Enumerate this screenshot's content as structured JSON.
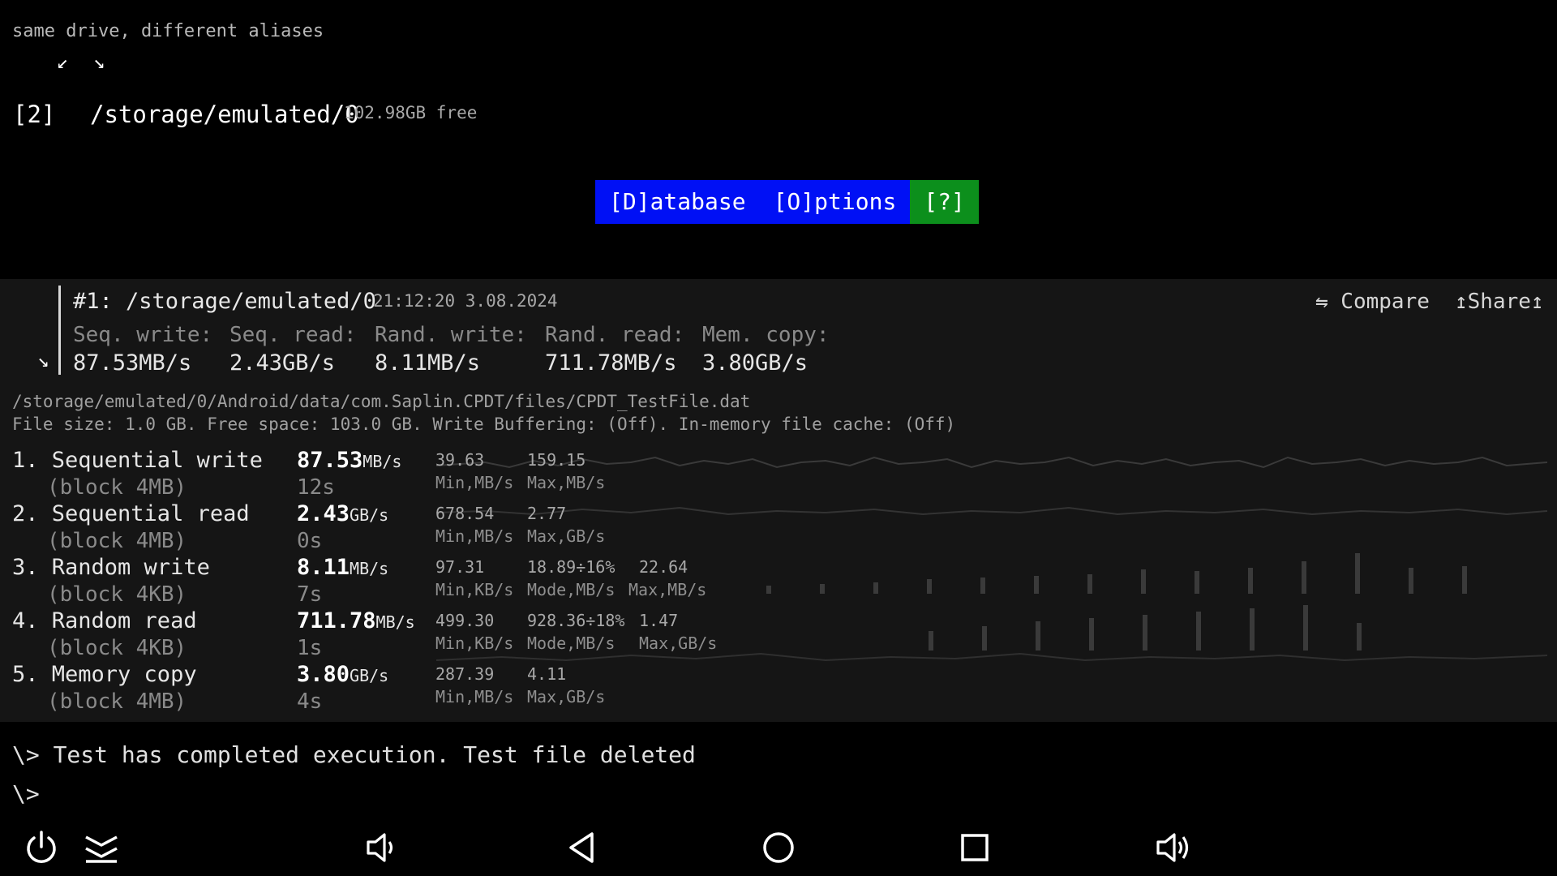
{
  "header": {
    "hint": "same drive, different aliases",
    "arrows": "↙ ↘",
    "drive_index": "[2]",
    "drive_path": "/storage/emulated/0",
    "drive_free": "102.98GB free"
  },
  "menu": {
    "database": "[D]atabase",
    "options": "[O]ptions",
    "help": "[?]"
  },
  "run": {
    "title": "#1: /storage/emulated/0",
    "timestamp": "21:12:20 3.08.2024",
    "compare": "⇋ Compare",
    "share": "↥Share↥",
    "collapse_arrow": "↘",
    "summary_labels": [
      "Seq. write:",
      "Seq. read:",
      "Rand. write:",
      "Rand. read:",
      "Mem. copy:"
    ],
    "summary_values": [
      "87.53MB/s",
      "2.43GB/s",
      "8.11MB/s",
      "711.78MB/s",
      "3.80GB/s"
    ]
  },
  "file": {
    "path": "/storage/emulated/0/Android/data/com.Saplin.CPDT/files/CPDT_TestFile.dat",
    "info": "File size: 1.0 GB. Free space: 103.0 GB. Write Buffering: (Off). In-memory file cache: (Off)"
  },
  "tests": [
    {
      "name": "1. Sequential write",
      "block": "(block 4MB)",
      "speed": "87.53",
      "unit": "MB/s",
      "duration": "12s",
      "stats": [
        "39.63",
        "159.15"
      ],
      "stat_labels": [
        "Min,MB/s",
        "Max,MB/s"
      ]
    },
    {
      "name": "2. Sequential read",
      "block": "(block 4MB)",
      "speed": "2.43",
      "unit": "GB/s",
      "duration": "0s",
      "stats": [
        "678.54",
        "2.77"
      ],
      "stat_labels": [
        "Min,MB/s",
        "Max,GB/s"
      ]
    },
    {
      "name": "3. Random write",
      "block": "(block 4KB)",
      "speed": "8.11",
      "unit": "MB/s",
      "duration": "7s",
      "stats": [
        "97.31",
        "18.89÷16%",
        "22.64"
      ],
      "stat_labels": [
        "Min,KB/s",
        "Mode,MB/s",
        "Max,MB/s"
      ]
    },
    {
      "name": "4. Random read",
      "block": "(block 4KB)",
      "speed": "711.78",
      "unit": "MB/s",
      "duration": "1s",
      "stats": [
        "499.30",
        "928.36÷18%",
        "1.47"
      ],
      "stat_labels": [
        "Min,KB/s",
        "Mode,MB/s",
        "Max,GB/s"
      ]
    },
    {
      "name": "5. Memory copy",
      "block": "(block 4MB)",
      "speed": "3.80",
      "unit": "GB/s",
      "duration": "4s",
      "stats": [
        "287.39",
        "4.11"
      ],
      "stat_labels": [
        "Min,MB/s",
        "Max,GB/s"
      ]
    }
  ],
  "terminal": {
    "line1": "\\> Test has completed execution. Test file deleted",
    "line2": "\\>"
  },
  "nav": {
    "icons": [
      "power-icon",
      "expand-icon",
      "volume-down-icon",
      "back-icon",
      "home-icon",
      "recents-icon",
      "volume-up-icon"
    ]
  },
  "colors": {
    "menu_blue": "#0010f5",
    "menu_green": "#0c8f1c",
    "panel_bg": "#151515"
  }
}
